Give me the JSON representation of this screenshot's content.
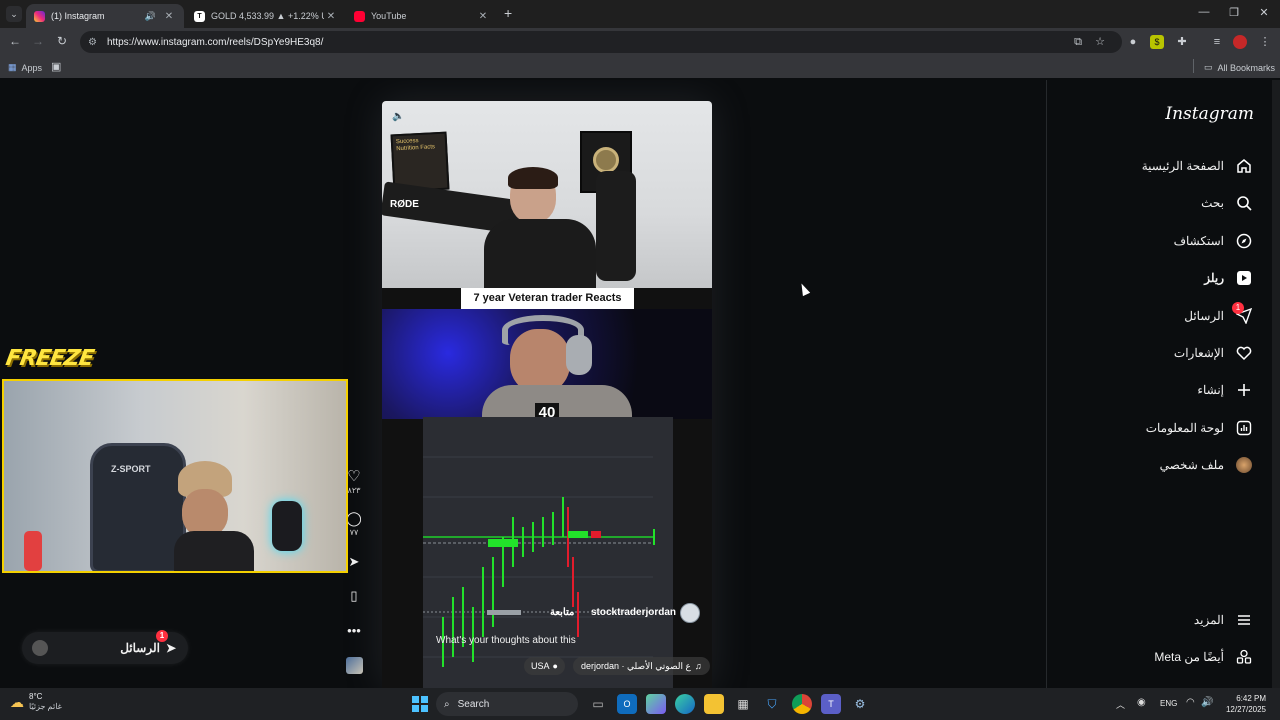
{
  "browser": {
    "tabs": [
      {
        "title": "(1) Instagram",
        "active": true
      },
      {
        "title": "GOLD 4,533.99 ▲ +1.22% Unn",
        "active": false
      },
      {
        "title": "YouTube",
        "active": false
      }
    ],
    "new_tab_label": "+",
    "url": "https://www.instagram.com/reels/DSpYe9HE3q8/",
    "bookmarks": {
      "apps": "Apps",
      "all": "All Bookmarks"
    }
  },
  "instagram": {
    "logo": "Instagram",
    "nav": [
      {
        "label": "الصفحة الرئيسية",
        "icon": "home-icon"
      },
      {
        "label": "بحث",
        "icon": "search-icon"
      },
      {
        "label": "استكشاف",
        "icon": "explore-icon"
      },
      {
        "label": "ريلز",
        "icon": "reels-icon"
      },
      {
        "label": "الرسائل",
        "icon": "messages-icon",
        "badge": "1"
      },
      {
        "label": "الإشعارات",
        "icon": "heart-icon"
      },
      {
        "label": "إنشاء",
        "icon": "plus-icon"
      },
      {
        "label": "لوحة المعلومات",
        "icon": "dashboard-icon"
      },
      {
        "label": "ملف شخصي",
        "icon": "profile-avatar"
      }
    ],
    "more": "المزيد",
    "also_from_meta": "أيضًا من Meta",
    "messages_pill": {
      "label": "الرسائل",
      "badge": "1"
    }
  },
  "reel": {
    "caption_banner": "7 year Veteran trader Reacts",
    "overlay_number": "40",
    "username": "stocktraderjordan",
    "follow": "متابعة",
    "caption": "What's your thoughts about this",
    "audio": "ع الصوتي الأصلي · derjordan",
    "location": "USA",
    "likes": "٨٢٣",
    "comments": "٧٧",
    "freeze_logo": "FREEZE",
    "chair_brand": "Z-SPORT",
    "mic_brand": "RØDE",
    "poster_text": "Success Nutrition Facts"
  },
  "taskbar": {
    "weather_temp": "8°C",
    "weather_desc": "غائم جزئيًا",
    "search": "Search",
    "lang": "ENG",
    "time": "6:42 PM",
    "date": "12/27/2025"
  },
  "colors": {
    "accent_yellow": "#f4d000",
    "ig_badge": "#ff3040",
    "chart_green": "#22e22a",
    "chart_red": "#e21c2c"
  }
}
